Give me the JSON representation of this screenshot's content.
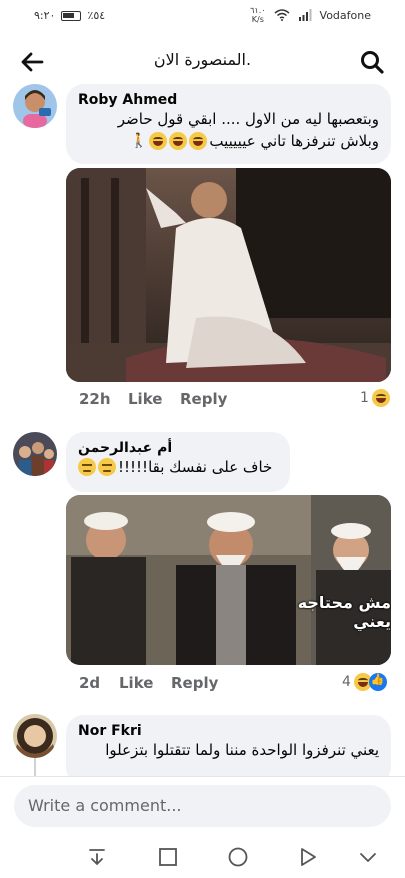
{
  "status": {
    "time": "٩:٢٠",
    "battery": "٪٥٤",
    "speed_value": "٦١.٠",
    "speed_unit": "K/s",
    "carrier": "Vodafone"
  },
  "header": {
    "title": "المنصورة الان."
  },
  "comments": [
    {
      "name": "Roby Ahmed",
      "text_line1": "وبتعصبها ليه من الاول .... ابقي قول حاضر",
      "text_line2": "وبلاش تنرفزها تاني عيييييب",
      "time": "22h",
      "like": "Like",
      "reply": "Reply",
      "reaction_count": "1"
    },
    {
      "name": "أم عبدالرحمن",
      "text_line1": "خاف على نفسك بقا!!!!!",
      "image_caption": "مش محتاجه يعني",
      "time": "2d",
      "like": "Like",
      "reply": "Reply",
      "reaction_count": "4"
    },
    {
      "name": "Nor Fkri",
      "text_line1": "يعني تنرفزوا الواحدة مننا ولما تتقتلوا بتزعلوا"
    }
  ],
  "composer": {
    "placeholder": "Write a comment..."
  },
  "colors": {
    "bubble": "#f0f2f5",
    "meta": "#65676b",
    "accent": "#1877f2"
  },
  "icons": [
    "back-arrow-icon",
    "search-icon",
    "laugh-emoji-icon",
    "like-emoji-icon",
    "nav-back-icon",
    "nav-home-icon",
    "nav-recents-icon",
    "nav-collapse-icon"
  ]
}
